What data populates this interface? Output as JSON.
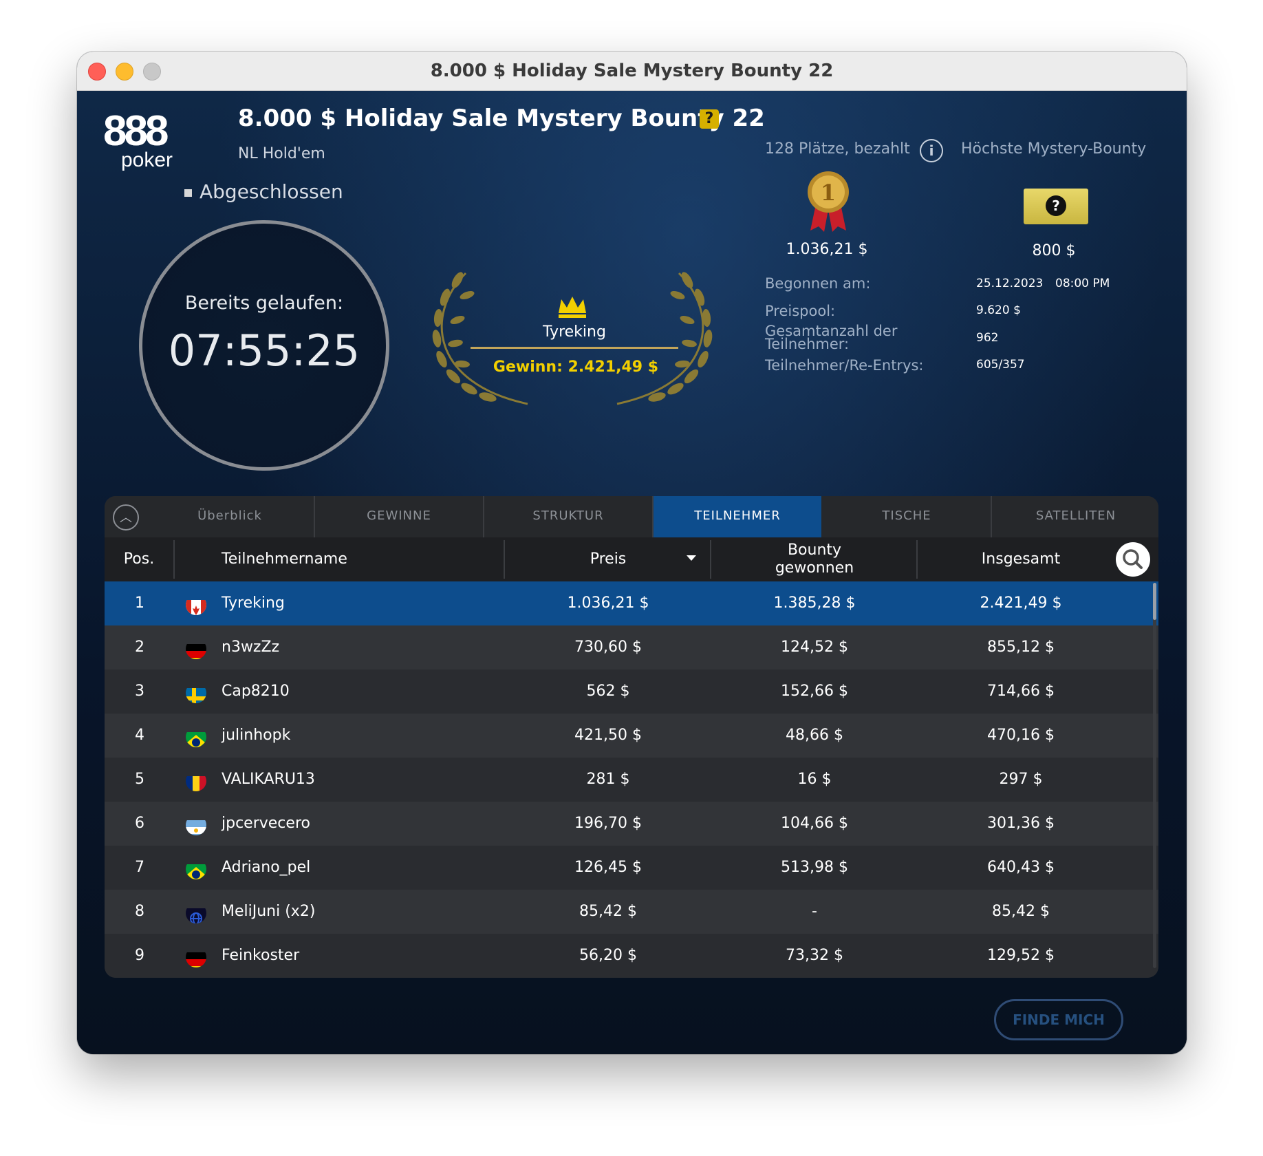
{
  "window": {
    "title": "8.000 $ Holiday Sale Mystery Bounty 22"
  },
  "brand": {
    "logo_top": "888",
    "logo_bottom": "poker"
  },
  "header": {
    "title": "8.000 $ Holiday Sale Mystery Bounty 22",
    "help_badge": "?",
    "game_type": "NL Hold'em",
    "status": "Abgeschlossen"
  },
  "timer": {
    "label": "Bereits gelaufen:",
    "value": "07:55:25"
  },
  "winner": {
    "icon": "crown-icon",
    "name": "Tyreking",
    "prize": "Gewinn: 2.421,49 $"
  },
  "summary": {
    "places_paid": "128 Plätze, bezahlt",
    "info_icon": "i",
    "mystery_label": "Höchste Mystery-Bounty",
    "first_prize": "1.036,21 $",
    "mystery_prize": "800 $",
    "ticket_symbol": "?",
    "started_label": "Begonnen am:",
    "started_date": "25.12.2023",
    "started_time": "08:00 PM",
    "prizepool_label": "Preispool:",
    "prizepool_value": "9.620 $",
    "participants_label_1": "Gesamtanzahl der",
    "participants_label_2": "Teilnehmer:",
    "participants_value": "962",
    "reentries_label": "Teilnehmer/Re-Entrys:",
    "reentries_value": "605/357"
  },
  "tabs": [
    {
      "label": "Überblick",
      "active": false
    },
    {
      "label": "GEWINNE",
      "active": false
    },
    {
      "label": "STRUKTUR",
      "active": false
    },
    {
      "label": "TEILNEHMER",
      "active": true
    },
    {
      "label": "TISCHE",
      "active": false
    },
    {
      "label": "SATELLITEN",
      "active": false
    }
  ],
  "table": {
    "headers": {
      "pos": "Pos.",
      "name": "Teilnehmername",
      "preis": "Preis",
      "bounty_1": "Bounty",
      "bounty_2": "gewonnen",
      "total": "Insgesamt"
    },
    "rows": [
      {
        "pos": "1",
        "flag": "canada-flag-icon",
        "name": "Tyreking",
        "preis": "1.036,21 $",
        "bounty": "1.385,28 $",
        "total": "2.421,49 $"
      },
      {
        "pos": "2",
        "flag": "germany-flag-icon",
        "name": "n3wzZz",
        "preis": "730,60 $",
        "bounty": "124,52 $",
        "total": "855,12 $"
      },
      {
        "pos": "3",
        "flag": "sweden-flag-icon",
        "name": "Cap8210",
        "preis": "562 $",
        "bounty": "152,66 $",
        "total": "714,66 $"
      },
      {
        "pos": "4",
        "flag": "brazil-flag-icon",
        "name": "julinhopk",
        "preis": "421,50 $",
        "bounty": "48,66 $",
        "total": "470,16 $"
      },
      {
        "pos": "5",
        "flag": "romania-flag-icon",
        "name": "VALIKARU13",
        "preis": "281 $",
        "bounty": "16 $",
        "total": "297 $"
      },
      {
        "pos": "6",
        "flag": "argentina-flag-icon",
        "name": "jpcervecero",
        "preis": "196,70 $",
        "bounty": "104,66 $",
        "total": "301,36 $"
      },
      {
        "pos": "7",
        "flag": "brazil-flag-icon",
        "name": "Adriano_pel",
        "preis": "126,45 $",
        "bounty": "513,98 $",
        "total": "640,43 $"
      },
      {
        "pos": "8",
        "flag": "globe-flag-icon",
        "name": "MeliJuni (x2)",
        "preis": "85,42 $",
        "bounty": "-",
        "total": "85,42 $"
      },
      {
        "pos": "9",
        "flag": "germany-flag-icon",
        "name": "Feinkoster",
        "preis": "56,20 $",
        "bounty": "73,32 $",
        "total": "129,52 $"
      }
    ]
  },
  "find_me": "FINDE MICH",
  "colors": {
    "accent": "#0d4d8d",
    "gold": "#f3d000",
    "background": "#0a1629"
  }
}
